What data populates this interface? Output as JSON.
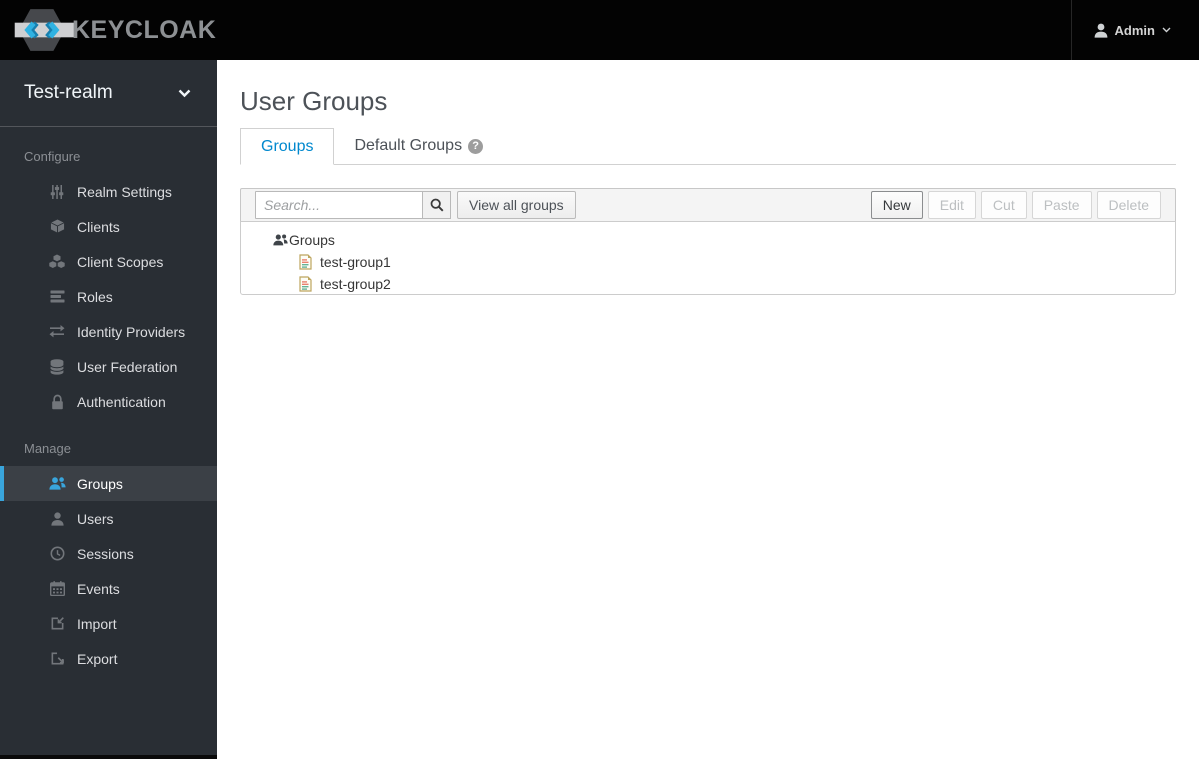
{
  "header": {
    "brand": "KEYCLOAK",
    "user_menu": {
      "label": "Admin"
    }
  },
  "sidebar": {
    "realm": "Test-realm",
    "configure": {
      "label": "Configure",
      "items": [
        {
          "label": "Realm Settings",
          "icon": "sliders-icon"
        },
        {
          "label": "Clients",
          "icon": "cube-icon"
        },
        {
          "label": "Client Scopes",
          "icon": "cubes-icon"
        },
        {
          "label": "Roles",
          "icon": "list-icon"
        },
        {
          "label": "Identity Providers",
          "icon": "exchange-icon"
        },
        {
          "label": "User Federation",
          "icon": "database-icon"
        },
        {
          "label": "Authentication",
          "icon": "lock-icon"
        }
      ]
    },
    "manage": {
      "label": "Manage",
      "items": [
        {
          "label": "Groups",
          "icon": "users-icon",
          "active": true
        },
        {
          "label": "Users",
          "icon": "user-icon"
        },
        {
          "label": "Sessions",
          "icon": "clock-icon"
        },
        {
          "label": "Events",
          "icon": "calendar-icon"
        },
        {
          "label": "Import",
          "icon": "import-icon"
        },
        {
          "label": "Export",
          "icon": "export-icon"
        }
      ]
    }
  },
  "main": {
    "title": "User Groups",
    "tabs": [
      {
        "label": "Groups",
        "active": true
      },
      {
        "label": "Default Groups",
        "help_icon": "question-circle-icon"
      }
    ],
    "toolbar": {
      "search_placeholder": "Search...",
      "search_icon": "search-icon",
      "view_all_label": "View all groups",
      "actions": [
        {
          "label": "New",
          "enabled": true
        },
        {
          "label": "Edit",
          "enabled": false
        },
        {
          "label": "Cut",
          "enabled": false
        },
        {
          "label": "Paste",
          "enabled": false
        },
        {
          "label": "Delete",
          "enabled": false
        }
      ]
    },
    "tree": {
      "root": {
        "label": "Groups",
        "icon": "users-icon"
      },
      "children": [
        {
          "label": "test-group1",
          "icon": "file-icon"
        },
        {
          "label": "test-group2",
          "icon": "file-icon"
        }
      ]
    }
  },
  "colors": {
    "accent": "#0088ce",
    "active_nav": "#39a5dc",
    "header_bg": "#030303",
    "sidebar_bg": "#292e34",
    "toolbar_bg": "#f4f4f4"
  }
}
